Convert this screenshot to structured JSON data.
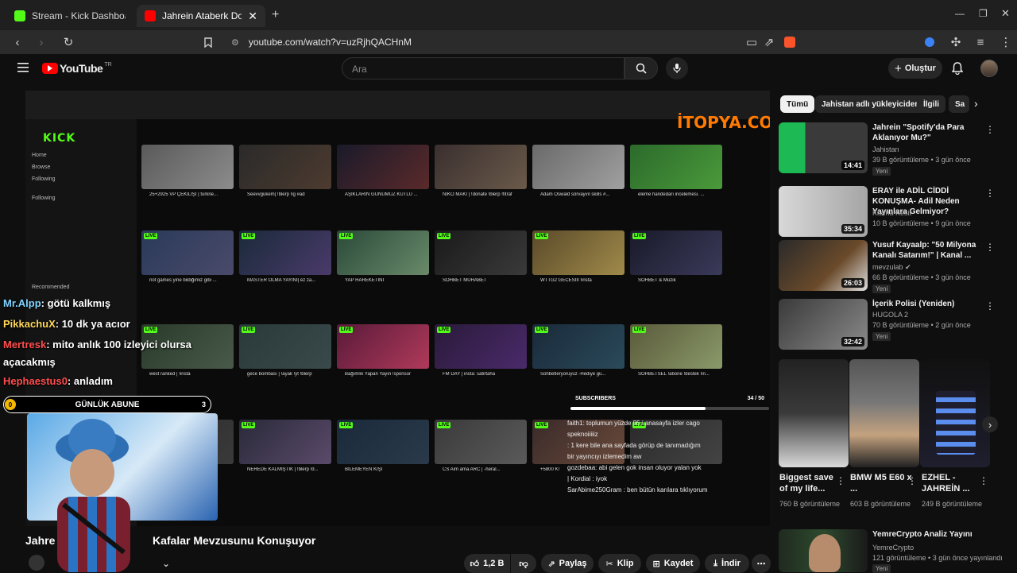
{
  "browser": {
    "tabs": [
      {
        "title": "Stream - Kick Dashboard",
        "active": false
      },
      {
        "title": "Jahrein Ataberk Doğan ve K",
        "active": true
      }
    ],
    "url": "youtube.com/watch?v=uzRjhQACHnM"
  },
  "youtube": {
    "logo_text": "YouTube",
    "logo_region": "TR",
    "search_placeholder": "Ara",
    "create_label": "Oluştur"
  },
  "stream": {
    "kick_logo": "KICK",
    "sidebar_items": [
      "Home",
      "Browse",
      "Following",
      "Following",
      "Recommended"
    ],
    "watermark": "İTOPYA.COM",
    "card_titles": [
      "25+2925 VP ÇEKİLİŞİ | turkne...",
      "Seevvgükem| !blerp !ig #ad",
      "AŞIKLARIN GÜNÜMÜZ KUTLU ...",
      "NİKO MAKİ | !donate !blerp !fitraf",
      "Adam Oswald sörvayvıl skills #...",
      "eleme handedarı incelemesi. ...",
      "riot games yine bildiğimiz gibi ...",
      "MASTER OLMA YAYINI| ez za...",
      "YAP HAREKETİNİ",
      "SOHBET MUHABET",
      "WTTG2 GECESİİİ !insta",
      "SOHBET & Müzik",
      "west ranked | !insta",
      "gece bombası | !ayak !yt !blerp",
      "Bağımlık Yapan Yayın !sponsor",
      "FM DAY | insta: satirtaha",
      "Sohbetleryoruyuz -Hediye gü...",
      "SOHBETSEL !abone !destek !in...",
      "",
      "NEREDE KALMIŞTIK | !blerp !d...",
      "BİLEMEYEN KİŞİ",
      "CS Aim ama ARC | -heral...",
      "+5800 K!",
      ""
    ],
    "chat": [
      {
        "user": "Mr.Alpp",
        "text": ": götü kalkmış",
        "color": "#7fd3ff"
      },
      {
        "user": "PikkachuX",
        "text": ": 10 dk ya acıor",
        "color": "#ffd75a"
      },
      {
        "user": "Mertresk",
        "text": ": mito anlık 100 izleyici olursa",
        "color": "#ff4d4d"
      },
      {
        "user": "",
        "text": "açacakmış",
        "color": "#ffffff"
      },
      {
        "user": "Hephaestus0",
        "text": ": anladım",
        "color": "#ff4d4d"
      }
    ],
    "sub_goal_label": "GÜNLÜK ABUNE",
    "sub_goal_current": "0",
    "sub_goal_target": "3",
    "overlay_subscribers_label": "SUBSCRIBERS",
    "overlay_subscribers_count": "34 / 50",
    "overlay_chat": [
      "faith1: toplumun yüzde 95 i anasayfa izler cago",
      "speknoiiiiiz",
      ": 1 kere bile ana sayfada görüp de tanımadığım",
      "bir yayıncıyı izlemedim aw",
      "gozdebaa: abi gelen gok insan oluyor yalan yok",
      "| Kordial : iyok",
      "SarAbime250Gram : ben bütün karılara tıklıyorum"
    ]
  },
  "video": {
    "title_left": "Jahre",
    "title_right": "Kafalar Mevzusunu Konuşuyor",
    "like_count": "1,2 B",
    "share_label": "Paylaş",
    "clip_label": "Klip",
    "save_label": "Kaydet",
    "download_label": "İndir"
  },
  "sidebar": {
    "chips": [
      "Tümü",
      "Jahistan adlı yükleyiciden",
      "İlgili",
      "Sa"
    ],
    "recommendations": [
      {
        "title": "Jahrein \"Spotify'da Para Aklanıyor Mu?\"",
        "channel": "Jahistan",
        "meta": "39 B görüntüleme • 3 gün önce",
        "badge": "Yeni",
        "duration": "14:41",
        "verified": false
      },
      {
        "title": "ERAY ile ADİL CİDDİ KONUŞMA- Adil Neden Yayınlara Gelmiyor?",
        "channel": "Karma Kesit",
        "meta": "10 B görüntüleme • 9 gün önce",
        "badge": "",
        "duration": "35:34",
        "verified": false
      },
      {
        "title": "Yusuf Kayaalp: \"50 Milyona Kanalı Satarım!\" | Kanal ...",
        "channel": "mevzulab",
        "meta": "66 B görüntüleme • 3 gün önce",
        "badge": "Yeni",
        "duration": "26:03",
        "verified": true
      },
      {
        "title": "İçerik Polisi (Yeniden)",
        "channel": "HUGOLA 2",
        "meta": "70 B görüntüleme • 2 gün önce",
        "badge": "Yeni",
        "duration": "32:42",
        "verified": false
      }
    ],
    "shorts": [
      {
        "title": "Biggest save of my life...",
        "meta": "760 B görüntüleme"
      },
      {
        "title": "BMW M5 E60 x ...",
        "meta": "603 B görüntüleme"
      },
      {
        "title": "EZHEL - JAHREİN ...",
        "meta": "249 B görüntüleme"
      }
    ],
    "live_rec": {
      "title": "YemreCrypto Analiz Yayını",
      "channel": "YemreCrypto",
      "meta": "121 görüntüleme • 3 gün önce yayınlandı",
      "badge": "Yeni"
    }
  }
}
